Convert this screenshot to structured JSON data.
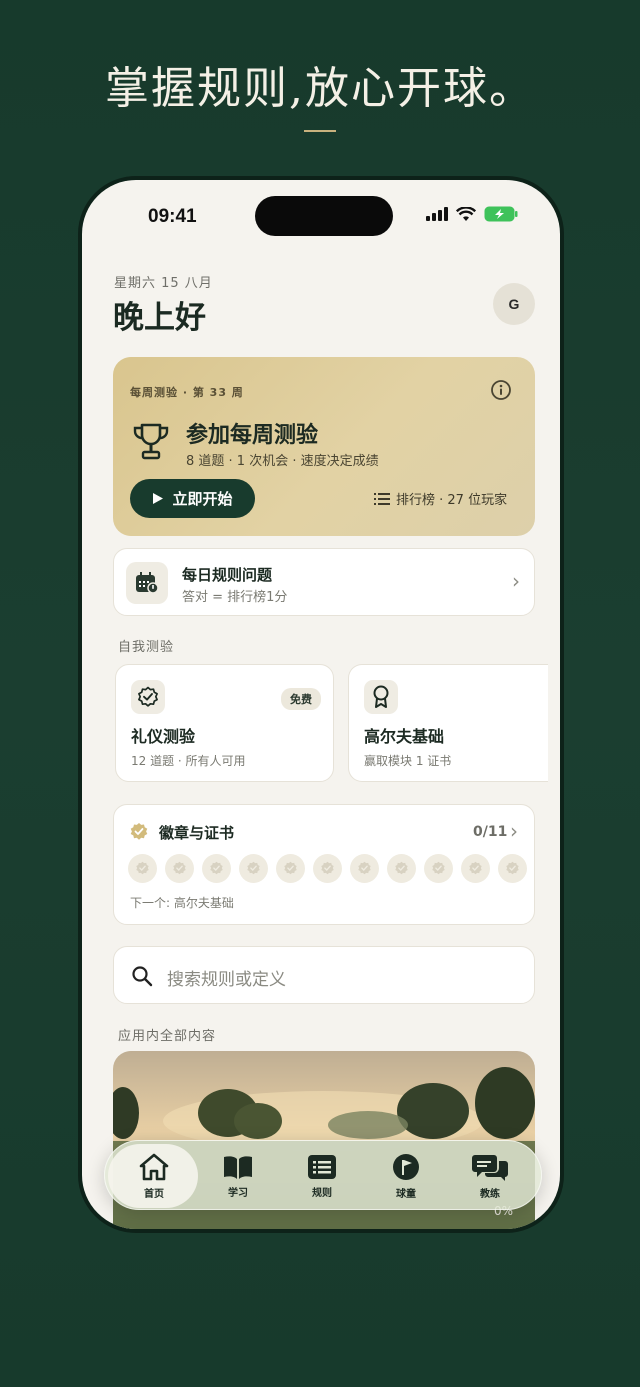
{
  "headline": "掌握规则,放心开球。",
  "status": {
    "time": "09:41"
  },
  "header": {
    "date": "星期六 15 八月",
    "greeting": "晚上好",
    "avatar_initial": "G"
  },
  "weekly": {
    "eyebrow": "每周测验 · 第 33 周",
    "title": "参加每周测验",
    "subtitle": "8 道题 · 1 次机会 · 速度决定成绩",
    "start_label": "立即开始",
    "leaderboard": "排行榜 · 27 位玩家"
  },
  "daily": {
    "title": "每日规则问题",
    "subtitle": "答对 = 排行榜1分"
  },
  "self_test": {
    "label": "自我测验",
    "cards": [
      {
        "title": "礼仪测验",
        "subtitle": "12 道题 · 所有人可用",
        "badge": "免费"
      },
      {
        "title": "高尔夫基础",
        "subtitle": "赢取模块 1 证书"
      }
    ]
  },
  "badges": {
    "title": "徽章与证书",
    "count": "0/11",
    "next": "下一个:  高尔夫基础",
    "total_slots": 11,
    "earned": 0
  },
  "search": {
    "placeholder": "搜索规则或定义"
  },
  "all_content": {
    "label": "应用内全部内容",
    "progress": "0%"
  },
  "tabs": [
    {
      "label": "首页",
      "icon": "home-icon",
      "active": true
    },
    {
      "label": "学习",
      "icon": "book-icon"
    },
    {
      "label": "规则",
      "icon": "rules-list-icon"
    },
    {
      "label": "球童",
      "icon": "flag-icon"
    },
    {
      "label": "教练",
      "icon": "chat-icon"
    }
  ],
  "colors": {
    "background": "#173a2c",
    "accent_gold": "#d9c58e",
    "primary_dark": "#183b2d",
    "surface": "#f5f3ee"
  }
}
